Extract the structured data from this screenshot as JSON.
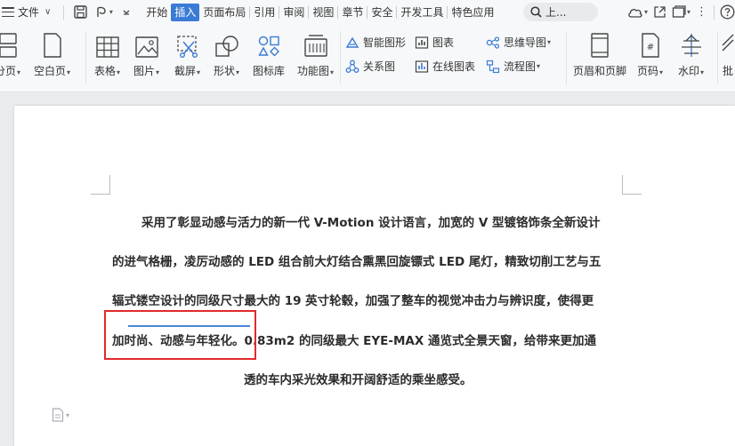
{
  "menubar": {
    "file_label": "文件",
    "tabs": [
      "开始",
      "插入",
      "页面布局",
      "引用",
      "审阅",
      "视图",
      "章节",
      "安全",
      "开发工具",
      "特色应用"
    ],
    "active_tab": "插入",
    "search_text": "上..."
  },
  "ribbon": {
    "page_break": "分页",
    "blank_page": "空白页",
    "table": "表格",
    "picture": "图片",
    "screenshot": "截屏",
    "shape": "形状",
    "icon_library": "图标库",
    "function_chart": "功能图",
    "smart_shape": "智能图形",
    "chart": "图表",
    "mind_map": "思维导图",
    "relation_chart": "关系图",
    "online_chart": "在线图表",
    "flowchart": "流程图",
    "header_footer": "页眉和页脚",
    "page_number": "页码",
    "watermark": "水印",
    "batch": "批"
  },
  "document": {
    "lines": [
      "采用了彰显动感与活力的新一代 V-Motion 设计语言，加宽的 V 型镀铬饰条全新设计",
      "的进气格栅，凌厉动感的 LED 组合前大灯结合熏黑回旋镖式 LED 尾灯，精致切削工艺与五",
      "辐式镂空设计的同级尺寸最大的 19 英寸轮毂，加强了整车的视觉冲击力与辨识度，使得更",
      "加时尚、动感与年轻化。0.83m2 的同级最大 EYE-MAX 通览式全景天窗，给带来更加通",
      "透的车内采光效果和开阔舒适的乘坐感受。"
    ]
  },
  "colors": {
    "accent": "#3a7bd5",
    "highlight_border": "#e02a2a",
    "ink_line": "#4a86d8"
  }
}
